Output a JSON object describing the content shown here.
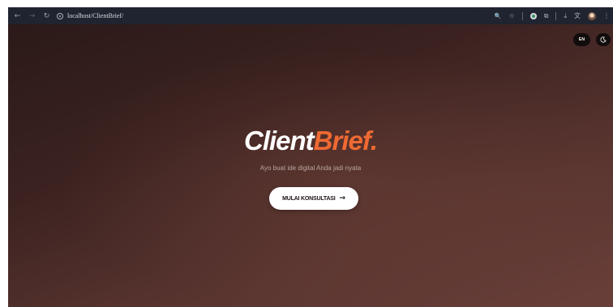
{
  "browser": {
    "nav": {
      "back_icon": "←",
      "forward_icon": "→",
      "reload_icon": "↻"
    },
    "url": "localhost/ClientBrief/",
    "tools": {
      "zoom_icon": "🔍",
      "star_icon": "☆",
      "puzzle_icon": "⧉",
      "download_icon": "⤓",
      "translate_icon": "文",
      "menu_icon": "⋮"
    }
  },
  "header": {
    "lang_label": "EN"
  },
  "hero": {
    "brand_word1": "Client",
    "brand_word2": "Brief.",
    "tagline": "Ayo buat ide digital Anda jadi nyata",
    "cta_label": "MULAI KONSULTASI",
    "cta_arrow": "→"
  },
  "colors": {
    "accent": "#ee6a33",
    "chrome": "#1f2430",
    "hero_dark": "#2b1a18",
    "hero_light": "#6a3f39"
  }
}
